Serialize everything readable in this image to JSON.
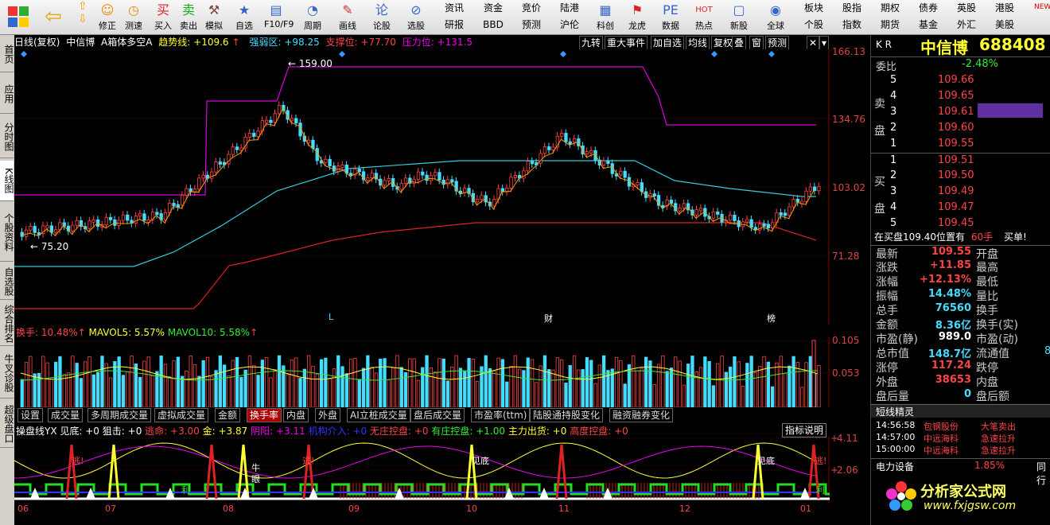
{
  "toolbar": {
    "buttons": [
      {
        "label": "修正"
      },
      {
        "label": "测速"
      },
      {
        "label": "买入"
      },
      {
        "label": "卖出"
      },
      {
        "label": "模拟"
      },
      {
        "label": "自选"
      },
      {
        "label": "F10/F9"
      },
      {
        "label": "周期"
      },
      {
        "label": "画线"
      },
      {
        "label": "论股"
      },
      {
        "label": "选股"
      },
      {
        "label": "科创"
      },
      {
        "label": "龙虎"
      },
      {
        "label": "数据"
      },
      {
        "label": "热点"
      },
      {
        "label": "新股"
      },
      {
        "label": "全球"
      }
    ],
    "small_top": [
      "资讯",
      "资金",
      "竞价",
      "陆港",
      "板块",
      "股指",
      "期权",
      "债券",
      "英股",
      "港股"
    ],
    "small_bottom": [
      "研报",
      "BBD",
      "预测",
      "沪伦",
      "个股",
      "指数",
      "期货",
      "基金",
      "外汇",
      "美股"
    ],
    "new_badge": "NEW"
  },
  "left_tabs": [
    "首页",
    "应用",
    "分时图",
    "K线图",
    "个股资料",
    "自选股",
    "综合排名",
    "牛叉诊股",
    "超级盘口"
  ],
  "chart": {
    "header": {
      "period": "日线(复权)",
      "name": "中信博",
      "indicator": "A箱体多空A",
      "trend": "趋势线: +109.6",
      "trend_arrow": "↑",
      "weak": "强弱区: +98.25",
      "support": "支撑位: +77.70",
      "pressure": "压力位: +131.5"
    },
    "header_buttons": [
      "九转",
      "重大事件",
      "加自选",
      "均线",
      "复权",
      "叠",
      "窗",
      "预测"
    ],
    "price_levels": [
      "166.13",
      "134.76",
      "103.02",
      "71.28"
    ],
    "high_mark": "159.00",
    "low_mark": "75.20",
    "event_marks": [
      "L",
      "财",
      "榜"
    ],
    "volume_header": {
      "turnover": "换手: 10.48%",
      "mavol5": "MAVOL5: 5.57%",
      "mavol10": "MAVOL10: 5.58%",
      "arrow": "↑"
    },
    "volume_levels": [
      "0.105",
      "0.053"
    ],
    "bottom_tabs": [
      "设置",
      "成交量",
      "多周期成交量",
      "虚拟成交量",
      "金额",
      "换手率",
      "内盘",
      "外盘",
      "AI立桩成交量",
      "盘后成交量",
      "市盈率(ttm)",
      "陆股通持股变化",
      "融资融券变化"
    ],
    "active_tab": "换手率",
    "indicator_header": {
      "name": "操盘线YX",
      "jiandi": "见底: +0",
      "juji": "狙击: +0",
      "taoming": "逃命: +3.00",
      "jin": "金: +3.87",
      "yinyang": "阴阳: +3.11",
      "jigou": "机构介入: +0",
      "wuzhuang": "无庄控盘: +0",
      "youzhuang": "有庄控盘: +1.00",
      "zhuli": "主力出货: +0",
      "gaodu": "高度控盘: +0"
    },
    "indicator_help": "指标说明",
    "indicator_levels": [
      "4.11",
      "2.06"
    ],
    "signal_labels": {
      "tao": "逃!",
      "jiandi": "见底",
      "niu": "牛",
      "yan": "眼",
      "li": "利"
    },
    "x_labels": [
      "06",
      "07",
      "08",
      "09",
      "10",
      "11",
      "12",
      "01"
    ]
  },
  "quote": {
    "market": "K R",
    "name": "中信博",
    "code": "688408",
    "weibi_label": "委比",
    "weibi": "-2.48%",
    "sell_label": "卖盘",
    "buy_label": "买盘",
    "sell": [
      {
        "lvl": "5",
        "price": "109.66"
      },
      {
        "lvl": "4",
        "price": "109.65"
      },
      {
        "lvl": "3",
        "price": "109.61"
      },
      {
        "lvl": "2",
        "price": "109.60"
      },
      {
        "lvl": "1",
        "price": "109.55"
      }
    ],
    "buy": [
      {
        "lvl": "1",
        "price": "109.51"
      },
      {
        "lvl": "2",
        "price": "109.50"
      },
      {
        "lvl": "3",
        "price": "109.49"
      },
      {
        "lvl": "4",
        "price": "109.47"
      },
      {
        "lvl": "5",
        "price": "109.45"
      }
    ],
    "order_info": "在买盘109.40位置有",
    "order_qty": "60手",
    "order_action": "买单!",
    "stats": [
      {
        "k": "最新",
        "v": "109.55",
        "k2": "开盘",
        "c": "red"
      },
      {
        "k": "涨跌",
        "v": "+11.85",
        "k2": "最高",
        "c": "red"
      },
      {
        "k": "涨幅",
        "v": "+12.13%",
        "k2": "最低",
        "c": "red"
      },
      {
        "k": "振幅",
        "v": "14.48%",
        "k2": "量比",
        "c": "cyan"
      },
      {
        "k": "总手",
        "v": "76560",
        "k2": "换手",
        "c": "cyan"
      },
      {
        "k": "金额",
        "v": "8.36亿",
        "k2": "换手(实)",
        "c": "cyan"
      },
      {
        "k": "市盈(静)",
        "v": "989.0",
        "k2": "市盈(动)",
        "c": "white"
      },
      {
        "k": "总市值",
        "v": "148.7亿",
        "k2": "流通值",
        "c": "cyan"
      },
      {
        "k": "涨停",
        "v": "117.24",
        "k2": "跌停",
        "c": "red"
      },
      {
        "k": "外盘",
        "v": "38653",
        "k2": "内盘",
        "c": "red"
      },
      {
        "k": "盘后量",
        "v": "0",
        "k2": "盘后额",
        "c": "cyan"
      }
    ],
    "liutong_partial": "8",
    "news_title": "短线精灵",
    "news": [
      {
        "time": "14:56:58",
        "name": "包钢股份",
        "event": "大笔卖出"
      },
      {
        "time": "14:57:00",
        "name": "中远海科",
        "event": "急速拉升"
      },
      {
        "time": "15:00:00",
        "name": "中远海科",
        "event": "急速拉升"
      }
    ],
    "sector": "电力设备",
    "sector_pct": "1.85%",
    "sector_extra": "同行",
    "watermark_cn": "分析家公式网",
    "watermark_url": "www.fxjgsw.com"
  }
}
